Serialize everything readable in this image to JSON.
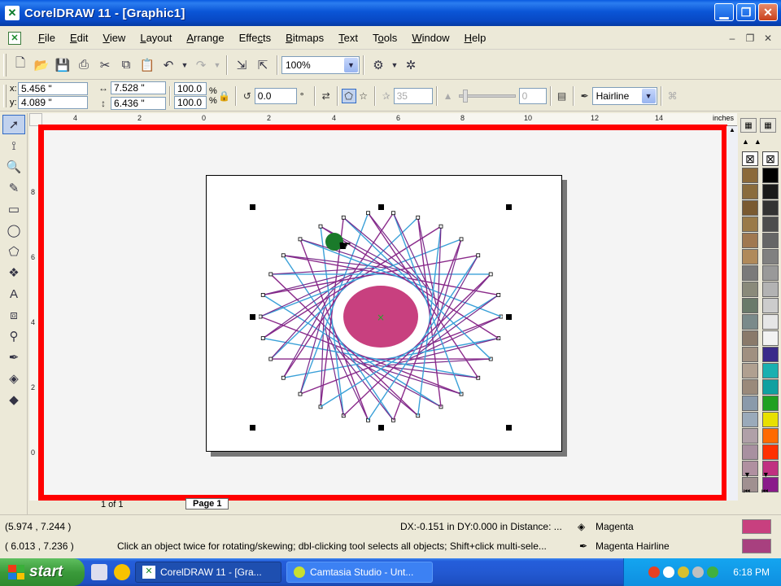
{
  "window": {
    "title": "CorelDRAW 11 - [Graphic1]"
  },
  "menu": [
    "File",
    "Edit",
    "View",
    "Layout",
    "Arrange",
    "Effects",
    "Bitmaps",
    "Text",
    "Tools",
    "Window",
    "Help"
  ],
  "menu_mnemonics": [
    "F",
    "E",
    "V",
    "L",
    "A",
    "c",
    "B",
    "T",
    "o",
    "W",
    "H"
  ],
  "toolbar": {
    "zoom": "100%"
  },
  "property_bar": {
    "x": "5.456 \"",
    "y": "4.089 \"",
    "width": "7.528 \"",
    "height": "6.436 \"",
    "scale_x": "100.0",
    "scale_y": "100.0",
    "percent": "%",
    "angle": "0.0",
    "degree": "°",
    "points": "35",
    "sharpness": "0",
    "outline": "Hairline"
  },
  "ruler": {
    "unit": "inches",
    "h_ticks": [
      "4",
      "2",
      "0",
      "2",
      "4",
      "6",
      "8",
      "10",
      "12",
      "14"
    ],
    "v_ticks": [
      "8",
      "6",
      "4",
      "2",
      "0"
    ]
  },
  "page_nav": {
    "of": "1 of 1",
    "page_tab": "Page 1"
  },
  "status": {
    "cursor_pos": "(5.974 , 7.244 )",
    "drag_pos": "( 6.013 , 7.236 )",
    "distance": "DX:-0.151 in DY:0.000 in Distance: ...",
    "hint": "Click an object twice for rotating/skewing; dbl-clicking tool selects all objects; Shift+click multi-sele...",
    "fill_name": "Magenta",
    "outline_name": "Magenta  Hairline",
    "fill_color": "#c8407f",
    "outline_color": "#a8407f"
  },
  "taskbar": {
    "start": "start",
    "tasks": [
      "CorelDRAW 11 - [Gra...",
      "Camtasia Studio - Unt..."
    ],
    "clock": "6:18 PM"
  },
  "palette": {
    "col1": [
      "#8b6a3a",
      "#8a6c3c",
      "#7a5a30",
      "#9a7a48",
      "#a07850",
      "#b08a5a",
      "#7a7a7a",
      "#8a8a7a",
      "#6a7a6a",
      "#7a8a8a",
      "#8a7a6a",
      "#a09080",
      "#b0a090",
      "#9a8a7a",
      "#8a9aaa",
      "#9aaaba",
      "#b0a0a8",
      "#a890a0",
      "#b090a0",
      "#a09090"
    ],
    "col2": [
      "#000000",
      "#1a1a1a",
      "#333333",
      "#4d4d4d",
      "#666666",
      "#808080",
      "#999999",
      "#b3b3b3",
      "#cccccc",
      "#e6e6e6",
      "#f2f2f2",
      "#3a2a8a",
      "#1ab0b0",
      "#10a0a0",
      "#20a020",
      "#e8e000",
      "#ff6a00",
      "#ff3000",
      "#c03080",
      "#8a1a8a"
    ]
  }
}
